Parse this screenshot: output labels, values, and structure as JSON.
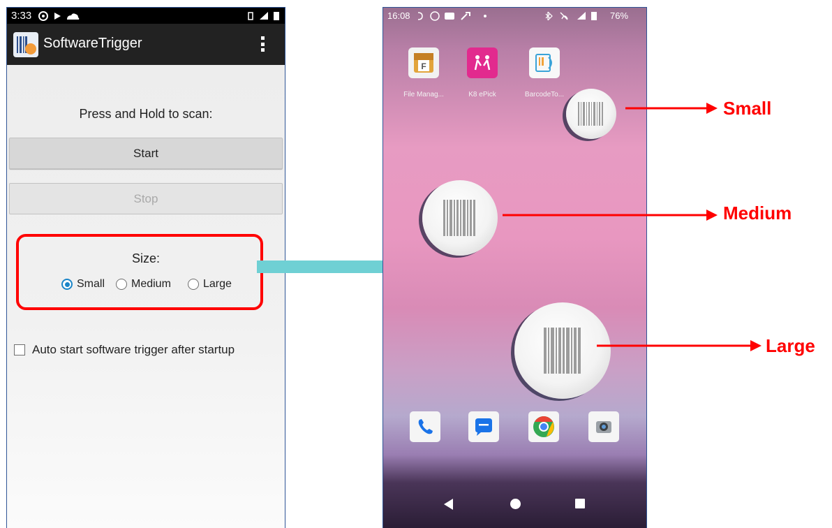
{
  "left": {
    "status": {
      "time": "3:33"
    },
    "app_title": "SoftwareTrigger",
    "prompt": "Press and Hold to scan:",
    "start_label": "Start",
    "stop_label": "Stop",
    "size_heading": "Size:",
    "size_options": [
      "Small",
      "Medium",
      "Large"
    ],
    "selected_size": "Small",
    "auto_start_label": "Auto start software trigger after startup",
    "auto_start_checked": false
  },
  "right": {
    "status": {
      "time": "16:08",
      "battery": "76%"
    },
    "apps": [
      {
        "label": "File Manag...",
        "icon": "file-manager-icon"
      },
      {
        "label": "K8 ePick",
        "icon": "k8-epick-icon"
      },
      {
        "label": "BarcodeTo...",
        "icon": "barcode-to-pc-icon"
      }
    ],
    "dock": [
      "phone-icon",
      "messages-icon",
      "chrome-icon",
      "camera-icon"
    ],
    "nav": [
      "back-icon",
      "home-icon",
      "recents-icon"
    ]
  },
  "annotations": {
    "small": "Small",
    "medium": "Medium",
    "large": "Large"
  },
  "colors": {
    "highlight_red": "#ff0000",
    "arrow_teal": "#6fd0d4",
    "radio_accent": "#1a85c8",
    "frame_blue": "#2f5597"
  }
}
